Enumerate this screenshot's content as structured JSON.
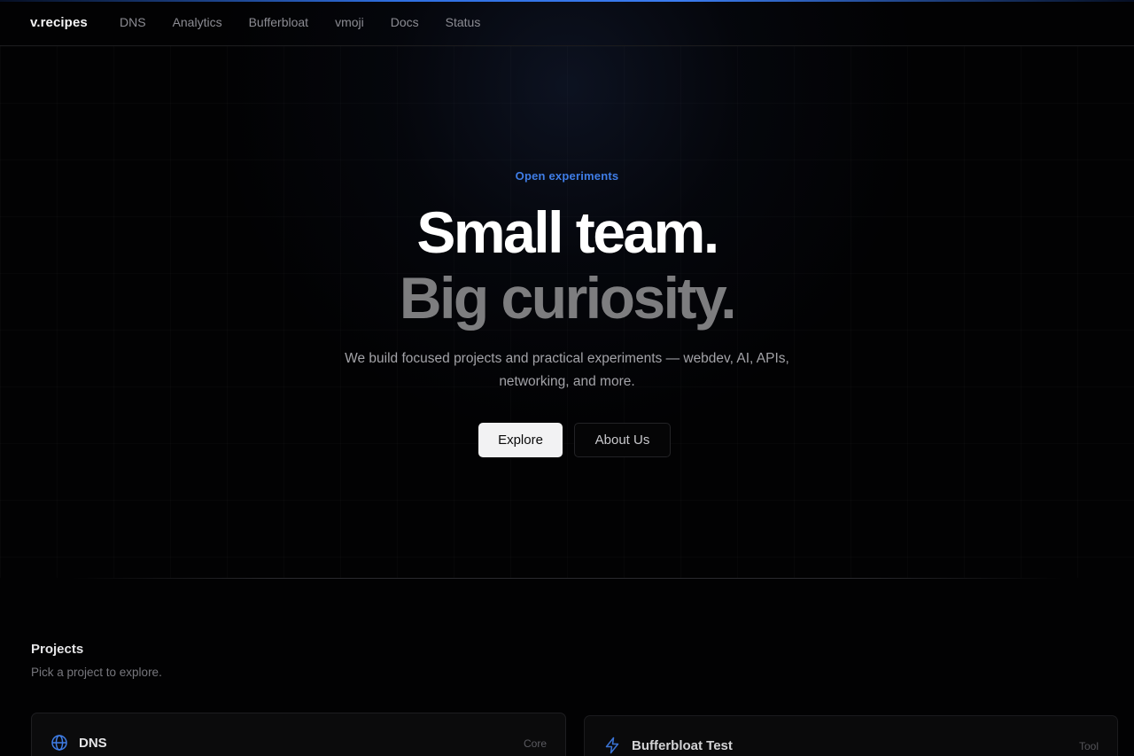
{
  "nav": {
    "brand": "v.recipes",
    "links": [
      "DNS",
      "Analytics",
      "Bufferbloat",
      "vmoji",
      "Docs",
      "Status"
    ]
  },
  "hero": {
    "eyebrow": "Open experiments",
    "headline_line1": "Small team.",
    "headline_line2": "Big curiosity.",
    "subtitle": "We build focused projects and practical experiments — webdev, AI, APIs, networking, and more.",
    "primary_button": "Explore",
    "secondary_button": "About Us"
  },
  "projects": {
    "title": "Projects",
    "subtitle": "Pick a project to explore.",
    "cards": [
      {
        "title": "DNS",
        "tag": "Core",
        "icon": "globe-icon"
      },
      {
        "title": "Bufferbloat Test",
        "tag": "Tool",
        "icon": "lightning-icon"
      }
    ]
  },
  "colors": {
    "accent": "#3f7de6",
    "background": "#020203",
    "headline_primary": "#ffffff",
    "headline_secondary": "#7d7d7f"
  }
}
